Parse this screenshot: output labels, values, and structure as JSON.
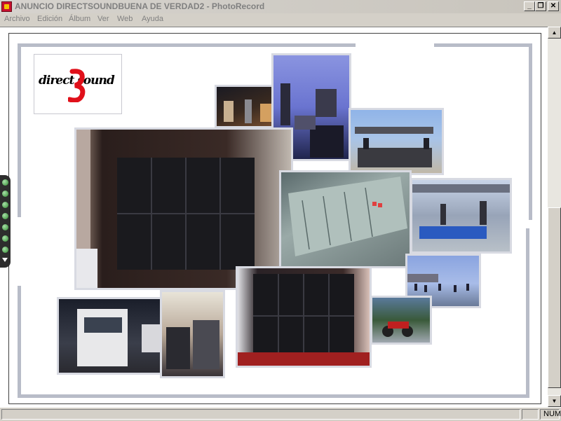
{
  "window": {
    "title": "ANUNCIO DIRECTSOUNDBUENA DE VERDAD2 - PhotoRecord",
    "minimize_glyph": "_",
    "restore_glyph": "❐",
    "close_glyph": "✕"
  },
  "menu": {
    "items": [
      "Archivo",
      "Edición",
      "Álbum",
      "Ver",
      "Web",
      "Ayuda"
    ]
  },
  "logo": {
    "text": "direct sound"
  },
  "scrollbar": {
    "up_glyph": "▲",
    "down_glyph": "▼"
  },
  "statusbar": {
    "num": "NUM"
  },
  "colors": {
    "frame_accent": "#b8bcc8",
    "logo_red": "#e0101a",
    "handle_green": "#3a9a3a"
  },
  "icons": {
    "app": "photorecord-app-icon",
    "side_dots": 8
  }
}
